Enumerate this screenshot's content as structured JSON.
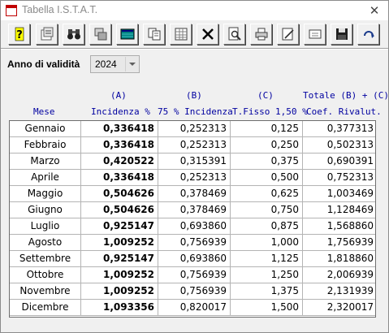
{
  "window": {
    "title": "Tabella I.S.T.A.T.",
    "close_symbol": "✕"
  },
  "toolbar": {
    "buttons": [
      {
        "name": "help-button",
        "icon": "question-mark-icon"
      },
      {
        "name": "properties-button",
        "icon": "properties-icon"
      },
      {
        "name": "find-button",
        "icon": "binoculars-icon"
      },
      {
        "name": "copy-window-button",
        "icon": "copy-window-icon"
      },
      {
        "name": "table-view-button",
        "icon": "table-icon"
      },
      {
        "name": "copy-button",
        "icon": "copy-document-icon"
      },
      {
        "name": "grid-button",
        "icon": "grid-icon"
      },
      {
        "name": "delete-button",
        "icon": "x-icon"
      },
      {
        "name": "preview-button",
        "icon": "magnifier-page-icon"
      },
      {
        "name": "print-button",
        "icon": "printer-icon"
      },
      {
        "name": "edit-button",
        "icon": "edit-page-icon"
      },
      {
        "name": "screen-button",
        "icon": "screen-icon"
      },
      {
        "name": "save-button",
        "icon": "floppy-disk-icon"
      },
      {
        "name": "refresh-button",
        "icon": "refresh-icon"
      }
    ]
  },
  "filter": {
    "label": "Anno di validità",
    "value": "2024"
  },
  "headers": {
    "mese": "Mese",
    "col1_top": "(A)",
    "col1_bottom": "Incidenza %",
    "col2_top": "(B)",
    "col2_bottom": "75 % Incidenza",
    "col3_top": "(C)",
    "col3_bottom": "T.Fisso 1,50 %",
    "col4_top": "Totale (B) + (C)",
    "col4_bottom": "Coef. Rivalut."
  },
  "rows": [
    {
      "mese": "Gennaio",
      "a": "0,336418",
      "b": "0,252313",
      "c": "0,125",
      "tot": "0,377313"
    },
    {
      "mese": "Febbraio",
      "a": "0,336418",
      "b": "0,252313",
      "c": "0,250",
      "tot": "0,502313"
    },
    {
      "mese": "Marzo",
      "a": "0,420522",
      "b": "0,315391",
      "c": "0,375",
      "tot": "0,690391"
    },
    {
      "mese": "Aprile",
      "a": "0,336418",
      "b": "0,252313",
      "c": "0,500",
      "tot": "0,752313"
    },
    {
      "mese": "Maggio",
      "a": "0,504626",
      "b": "0,378469",
      "c": "0,625",
      "tot": "1,003469"
    },
    {
      "mese": "Giugno",
      "a": "0,504626",
      "b": "0,378469",
      "c": "0,750",
      "tot": "1,128469"
    },
    {
      "mese": "Luglio",
      "a": "0,925147",
      "b": "0,693860",
      "c": "0,875",
      "tot": "1,568860"
    },
    {
      "mese": "Agosto",
      "a": "1,009252",
      "b": "0,756939",
      "c": "1,000",
      "tot": "1,756939"
    },
    {
      "mese": "Settembre",
      "a": "0,925147",
      "b": "0,693860",
      "c": "1,125",
      "tot": "1,818860"
    },
    {
      "mese": "Ottobre",
      "a": "1,009252",
      "b": "0,756939",
      "c": "1,250",
      "tot": "2,006939"
    },
    {
      "mese": "Novembre",
      "a": "1,009252",
      "b": "0,756939",
      "c": "1,375",
      "tot": "2,131939"
    },
    {
      "mese": "Dicembre",
      "a": "1,093356",
      "b": "0,820017",
      "c": "1,500",
      "tot": "2,320017"
    }
  ],
  "colors": {
    "header_text": "#0000a0",
    "title_text": "#8a8a8a"
  }
}
